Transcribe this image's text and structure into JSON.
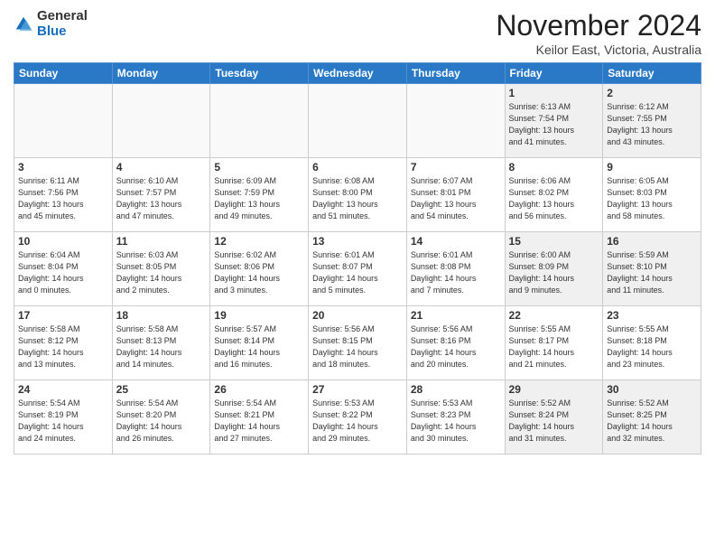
{
  "logo": {
    "general": "General",
    "blue": "Blue"
  },
  "header": {
    "month": "November 2024",
    "location": "Keilor East, Victoria, Australia"
  },
  "weekdays": [
    "Sunday",
    "Monday",
    "Tuesday",
    "Wednesday",
    "Thursday",
    "Friday",
    "Saturday"
  ],
  "weeks": [
    [
      {
        "day": "",
        "info": ""
      },
      {
        "day": "",
        "info": ""
      },
      {
        "day": "",
        "info": ""
      },
      {
        "day": "",
        "info": ""
      },
      {
        "day": "",
        "info": ""
      },
      {
        "day": "1",
        "info": "Sunrise: 6:13 AM\nSunset: 7:54 PM\nDaylight: 13 hours\nand 41 minutes."
      },
      {
        "day": "2",
        "info": "Sunrise: 6:12 AM\nSunset: 7:55 PM\nDaylight: 13 hours\nand 43 minutes."
      }
    ],
    [
      {
        "day": "3",
        "info": "Sunrise: 6:11 AM\nSunset: 7:56 PM\nDaylight: 13 hours\nand 45 minutes."
      },
      {
        "day": "4",
        "info": "Sunrise: 6:10 AM\nSunset: 7:57 PM\nDaylight: 13 hours\nand 47 minutes."
      },
      {
        "day": "5",
        "info": "Sunrise: 6:09 AM\nSunset: 7:59 PM\nDaylight: 13 hours\nand 49 minutes."
      },
      {
        "day": "6",
        "info": "Sunrise: 6:08 AM\nSunset: 8:00 PM\nDaylight: 13 hours\nand 51 minutes."
      },
      {
        "day": "7",
        "info": "Sunrise: 6:07 AM\nSunset: 8:01 PM\nDaylight: 13 hours\nand 54 minutes."
      },
      {
        "day": "8",
        "info": "Sunrise: 6:06 AM\nSunset: 8:02 PM\nDaylight: 13 hours\nand 56 minutes."
      },
      {
        "day": "9",
        "info": "Sunrise: 6:05 AM\nSunset: 8:03 PM\nDaylight: 13 hours\nand 58 minutes."
      }
    ],
    [
      {
        "day": "10",
        "info": "Sunrise: 6:04 AM\nSunset: 8:04 PM\nDaylight: 14 hours\nand 0 minutes."
      },
      {
        "day": "11",
        "info": "Sunrise: 6:03 AM\nSunset: 8:05 PM\nDaylight: 14 hours\nand 2 minutes."
      },
      {
        "day": "12",
        "info": "Sunrise: 6:02 AM\nSunset: 8:06 PM\nDaylight: 14 hours\nand 3 minutes."
      },
      {
        "day": "13",
        "info": "Sunrise: 6:01 AM\nSunset: 8:07 PM\nDaylight: 14 hours\nand 5 minutes."
      },
      {
        "day": "14",
        "info": "Sunrise: 6:01 AM\nSunset: 8:08 PM\nDaylight: 14 hours\nand 7 minutes."
      },
      {
        "day": "15",
        "info": "Sunrise: 6:00 AM\nSunset: 8:09 PM\nDaylight: 14 hours\nand 9 minutes."
      },
      {
        "day": "16",
        "info": "Sunrise: 5:59 AM\nSunset: 8:10 PM\nDaylight: 14 hours\nand 11 minutes."
      }
    ],
    [
      {
        "day": "17",
        "info": "Sunrise: 5:58 AM\nSunset: 8:12 PM\nDaylight: 14 hours\nand 13 minutes."
      },
      {
        "day": "18",
        "info": "Sunrise: 5:58 AM\nSunset: 8:13 PM\nDaylight: 14 hours\nand 14 minutes."
      },
      {
        "day": "19",
        "info": "Sunrise: 5:57 AM\nSunset: 8:14 PM\nDaylight: 14 hours\nand 16 minutes."
      },
      {
        "day": "20",
        "info": "Sunrise: 5:56 AM\nSunset: 8:15 PM\nDaylight: 14 hours\nand 18 minutes."
      },
      {
        "day": "21",
        "info": "Sunrise: 5:56 AM\nSunset: 8:16 PM\nDaylight: 14 hours\nand 20 minutes."
      },
      {
        "day": "22",
        "info": "Sunrise: 5:55 AM\nSunset: 8:17 PM\nDaylight: 14 hours\nand 21 minutes."
      },
      {
        "day": "23",
        "info": "Sunrise: 5:55 AM\nSunset: 8:18 PM\nDaylight: 14 hours\nand 23 minutes."
      }
    ],
    [
      {
        "day": "24",
        "info": "Sunrise: 5:54 AM\nSunset: 8:19 PM\nDaylight: 14 hours\nand 24 minutes."
      },
      {
        "day": "25",
        "info": "Sunrise: 5:54 AM\nSunset: 8:20 PM\nDaylight: 14 hours\nand 26 minutes."
      },
      {
        "day": "26",
        "info": "Sunrise: 5:54 AM\nSunset: 8:21 PM\nDaylight: 14 hours\nand 27 minutes."
      },
      {
        "day": "27",
        "info": "Sunrise: 5:53 AM\nSunset: 8:22 PM\nDaylight: 14 hours\nand 29 minutes."
      },
      {
        "day": "28",
        "info": "Sunrise: 5:53 AM\nSunset: 8:23 PM\nDaylight: 14 hours\nand 30 minutes."
      },
      {
        "day": "29",
        "info": "Sunrise: 5:52 AM\nSunset: 8:24 PM\nDaylight: 14 hours\nand 31 minutes."
      },
      {
        "day": "30",
        "info": "Sunrise: 5:52 AM\nSunset: 8:25 PM\nDaylight: 14 hours\nand 32 minutes."
      }
    ]
  ]
}
